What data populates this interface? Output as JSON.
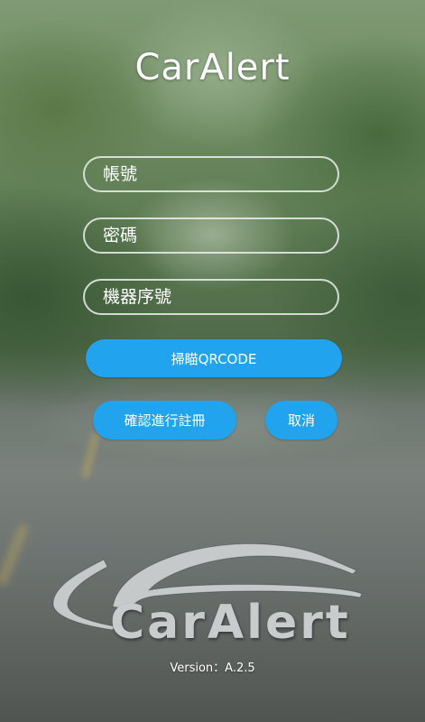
{
  "app": {
    "title": "CarAlert"
  },
  "form": {
    "account_placeholder": "帳號",
    "password_placeholder": "密碼",
    "serial_placeholder": "機器序號",
    "scan_label": "掃瞄QRCODE",
    "register_label": "確認進行註冊",
    "cancel_label": "取消"
  },
  "logo": {
    "text": "CarAlert"
  },
  "footer": {
    "version": "Version：A.2.5"
  },
  "colors": {
    "accent": "#22a3ee",
    "field_border": "#ebf0eb",
    "text": "#ffffff"
  },
  "icons": {
    "logo": "car-silhouette-logo-icon"
  }
}
